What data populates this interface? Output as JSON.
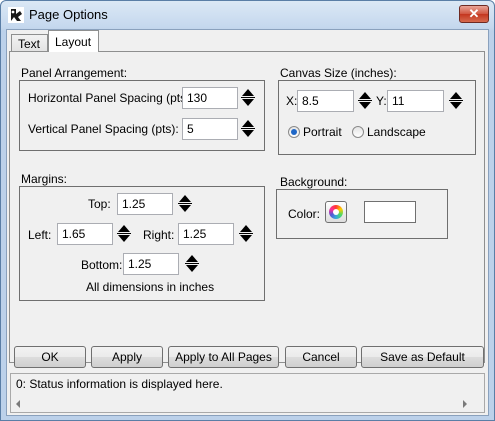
{
  "window": {
    "title": "Page Options",
    "close_glyph": "✕"
  },
  "tabs": [
    {
      "label": "Text"
    },
    {
      "label": "Layout"
    }
  ],
  "panel_arrangement": {
    "group_label": "Panel Arrangement:",
    "horizontal_label": "Horizontal Panel Spacing (pts):",
    "horizontal_value": "130",
    "vertical_label": "Vertical Panel Spacing (pts):",
    "vertical_value": "5"
  },
  "canvas_size": {
    "group_label": "Canvas Size (inches):",
    "x_label": "X:",
    "x_value": "8.5",
    "y_label": "Y:",
    "y_value": "11",
    "portrait_label": "Portrait",
    "landscape_label": "Landscape",
    "orientation_selected": "Portrait"
  },
  "margins": {
    "group_label": "Margins:",
    "top_label": "Top:",
    "top_value": "1.25",
    "left_label": "Left:",
    "left_value": "1.65",
    "right_label": "Right:",
    "right_value": "1.25",
    "bottom_label": "Bottom:",
    "bottom_value": "1.25",
    "note": "All dimensions in inches"
  },
  "background": {
    "group_label": "Background:",
    "color_label": "Color:",
    "color_value": "#ffffff",
    "color_icon": "color-wheel-icon"
  },
  "buttons": {
    "ok": "OK",
    "apply": "Apply",
    "apply_all": "Apply to All Pages",
    "cancel": "Cancel",
    "save_default": "Save as Default"
  },
  "status": {
    "text": "0: Status information is displayed here."
  }
}
